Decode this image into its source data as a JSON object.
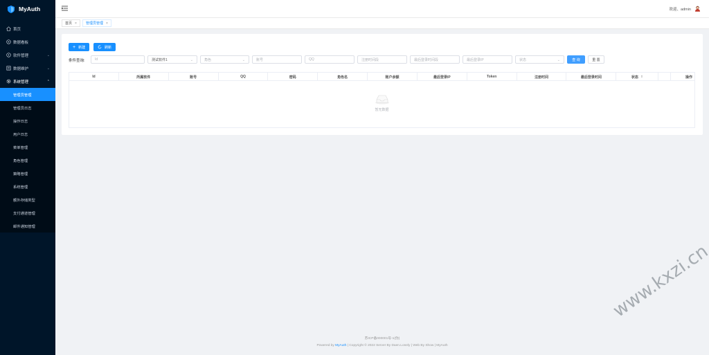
{
  "app": {
    "title": "MyAuth"
  },
  "sidebar": {
    "items": [
      {
        "label": "首页",
        "icon": "home-icon"
      },
      {
        "label": "数据看板",
        "icon": "dashboard-icon"
      },
      {
        "label": "软件管理",
        "icon": "info-icon",
        "expandable": true
      },
      {
        "label": "数据维护",
        "icon": "database-icon",
        "expandable": true
      },
      {
        "label": "系统管理",
        "icon": "gear-icon",
        "expandable": true,
        "open": true
      }
    ],
    "sub_items": [
      {
        "label": "管理员管理",
        "active": true
      },
      {
        "label": "管理员日志"
      },
      {
        "label": "操作日志"
      },
      {
        "label": "用户日志"
      },
      {
        "label": "菜单管理"
      },
      {
        "label": "角色管理"
      },
      {
        "label": "策略管理"
      },
      {
        "label": "系统管理"
      },
      {
        "label": "额外存储类型"
      },
      {
        "label": "支付通道管理"
      },
      {
        "label": "邮件通知管理"
      }
    ]
  },
  "header": {
    "welcome": "欢迎、admin"
  },
  "tabs": [
    {
      "label": "首页"
    },
    {
      "label": "管理员管理",
      "active": true
    }
  ],
  "toolbar": {
    "new_label": "新建",
    "refresh_label": "刷新"
  },
  "filters": {
    "label": "条件查询:",
    "id_placeholder": "Id",
    "software_value": "测试软件1",
    "role_placeholder": "角色",
    "account_placeholder": "账号",
    "qq_placeholder": "QQ",
    "register_time_placeholder": "注册时间段",
    "last_login_time_placeholder": "最后登录时间段",
    "last_login_ip_placeholder": "最后登录IP",
    "status_placeholder": "状态",
    "query_label": "查 询",
    "reset_label": "重 置"
  },
  "table": {
    "columns": [
      "Id",
      "所属软件",
      "账号",
      "QQ",
      "密码",
      "角色名",
      "账户余额",
      "最后登录IP",
      "Token",
      "注册时间",
      "最后登录时间",
      "状态",
      "",
      "操作"
    ],
    "empty_text": "暂无数据"
  },
  "footer": {
    "icp": "苏ICP备000001号-1(伪)",
    "powered_prefix": "Powered by",
    "powered_link": "MyAuth",
    "rest": "| Copyright © 2022 Server By Daen.Lonely | Web By Show | MyAuth"
  },
  "watermark": "www.kxzi.cn",
  "colors": {
    "sidebar_bg": "#001529",
    "accent": "#1890ff",
    "page_bg": "#f0f2f5"
  }
}
